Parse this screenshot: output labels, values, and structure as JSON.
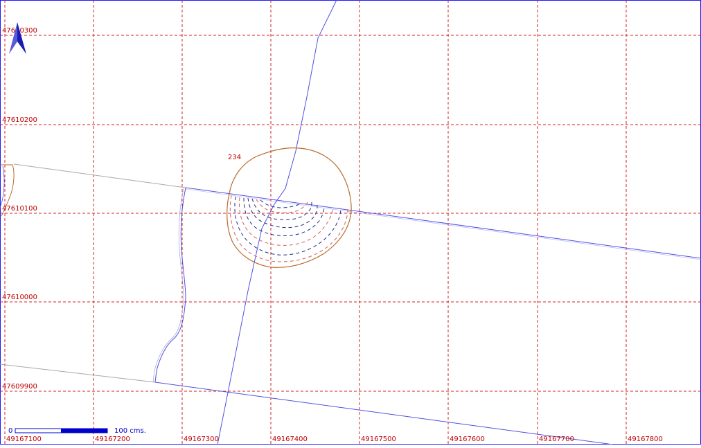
{
  "map": {
    "grid": {
      "x_labels": [
        "49167100",
        "49167200",
        "49167300",
        "49167400",
        "49167500",
        "49167600",
        "49167700",
        "49167800"
      ],
      "y_labels": [
        "47610300",
        "47610200",
        "47610100",
        "47610000",
        "47609900"
      ],
      "line_color": "#d32020",
      "label_color": "#c00000"
    },
    "contour_label": "234",
    "scale_bar": {
      "start_label": "0",
      "end_label": "100 cms.",
      "color": "#0000cc"
    },
    "north_arrow": {
      "icon": "north-arrow-icon",
      "color": "#1a1ab4"
    },
    "colors": {
      "frame": "#1a1aff",
      "road": "#5050e0",
      "road_gray": "#a8a8a8",
      "contour_main": "#b86a28",
      "contour_dash_blue": "#1a2a8c",
      "contour_dash_red": "#d06060"
    }
  }
}
